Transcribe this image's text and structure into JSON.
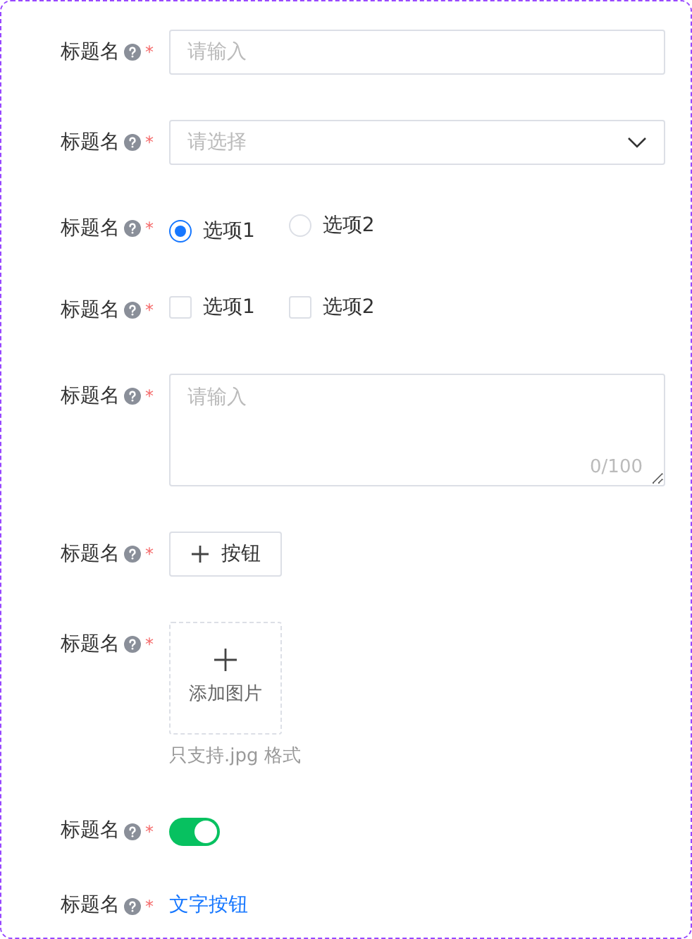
{
  "fields": [
    {
      "kind": "input",
      "label": "标题名",
      "required_mark": "*",
      "placeholder": "请输入"
    },
    {
      "kind": "select",
      "label": "标题名",
      "required_mark": "*",
      "placeholder": "请选择"
    },
    {
      "kind": "radio",
      "label": "标题名",
      "required_mark": "*",
      "options": [
        {
          "label": "选项1",
          "selected": true
        },
        {
          "label": "选项2",
          "selected": false
        }
      ]
    },
    {
      "kind": "checkbox",
      "label": "标题名",
      "required_mark": "*",
      "options": [
        {
          "label": "选项1",
          "checked": false
        },
        {
          "label": "选项2",
          "checked": false
        }
      ]
    },
    {
      "kind": "textarea",
      "label": "标题名",
      "required_mark": "*",
      "placeholder": "请输入",
      "counter": "0/100"
    },
    {
      "kind": "button",
      "label": "标题名",
      "required_mark": "*",
      "button_label": "按钮"
    },
    {
      "kind": "upload",
      "label": "标题名",
      "required_mark": "*",
      "upload_label": "添加图片",
      "hint": "只支持.jpg 格式"
    },
    {
      "kind": "switch",
      "label": "标题名",
      "required_mark": "*",
      "on": true
    },
    {
      "kind": "link",
      "label": "标题名",
      "required_mark": "*",
      "link_label": "文字按钮"
    }
  ]
}
